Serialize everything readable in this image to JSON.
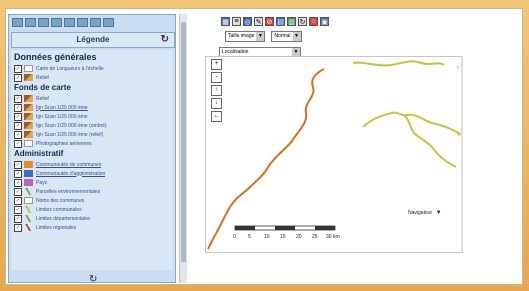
{
  "legend": {
    "title": "Légende",
    "refresh_icon": "refresh-icon",
    "sections": [
      {
        "heading": "Données générales",
        "size": "big",
        "rows": [
          {
            "label": "Carte de Longueurs à l'échelle",
            "icon": "white",
            "checked": true,
            "underline": false
          },
          {
            "label": "Relief",
            "icon": "mount",
            "checked": true,
            "underline": false
          }
        ]
      },
      {
        "heading": "Fonds de carte",
        "size": "small",
        "rows": [
          {
            "label": "Relief",
            "icon": "mount",
            "checked": true,
            "underline": false
          },
          {
            "label": "Ign Scan 1/25 000 ème",
            "icon": "mount",
            "checked": true,
            "underline": true
          },
          {
            "label": "Ign Scan 1/25 000 ème",
            "icon": "mount",
            "checked": true,
            "underline": false
          },
          {
            "label": "Ign Scan 1/25 000 ème (ombré)",
            "icon": "mount",
            "checked": true,
            "underline": false
          },
          {
            "label": "Ign Scan 1/25 000 ème (relief)",
            "icon": "mount",
            "checked": true,
            "underline": false
          },
          {
            "label": "Photographies aériennes",
            "icon": "white",
            "checked": true,
            "underline": false
          }
        ]
      },
      {
        "heading": "Administratif",
        "size": "small",
        "rows": [
          {
            "label": "Communautés de communes",
            "icon": "orange",
            "checked": true,
            "underline": true
          },
          {
            "label": "Communautés d'agglomération",
            "icon": "blue",
            "checked": true,
            "underline": true
          },
          {
            "label": "Pays",
            "icon": "purple",
            "checked": true,
            "underline": false
          },
          {
            "label": "Parcelles environnementales",
            "icon": "greenline",
            "checked": true,
            "underline": false
          },
          {
            "label": "Noms des communes",
            "icon": "white",
            "checked": true,
            "underline": false
          },
          {
            "label": "Limites communales",
            "icon": "yellowline",
            "checked": true,
            "underline": false
          },
          {
            "label": "Limites départementales",
            "icon": "greenline",
            "checked": true,
            "underline": false
          },
          {
            "label": "Limites régionales",
            "icon": "redline",
            "checked": true,
            "underline": false
          }
        ]
      }
    ],
    "bottom_refresh": "↻"
  },
  "toolbar": {
    "icons": [
      "grid-icon",
      "list-icon",
      "target-icon",
      "pencil-icon",
      "cancel-icon",
      "map-icon",
      "layers-icon",
      "refresh-icon",
      "home-icon",
      "print-icon"
    ],
    "size_select": "Taille image",
    "mode_select": "Normal",
    "combo_value": "Localisation"
  },
  "map": {
    "zoom_buttons": [
      "+",
      "-",
      "↑",
      "↓",
      "←"
    ],
    "nav_select": "Navigateur",
    "scale_labels": [
      "0",
      "5",
      "10",
      "15",
      "20",
      "25",
      "30 km"
    ]
  },
  "colors": {
    "orange_border": "#d8701c",
    "yellow_border": "#c7c43a"
  }
}
